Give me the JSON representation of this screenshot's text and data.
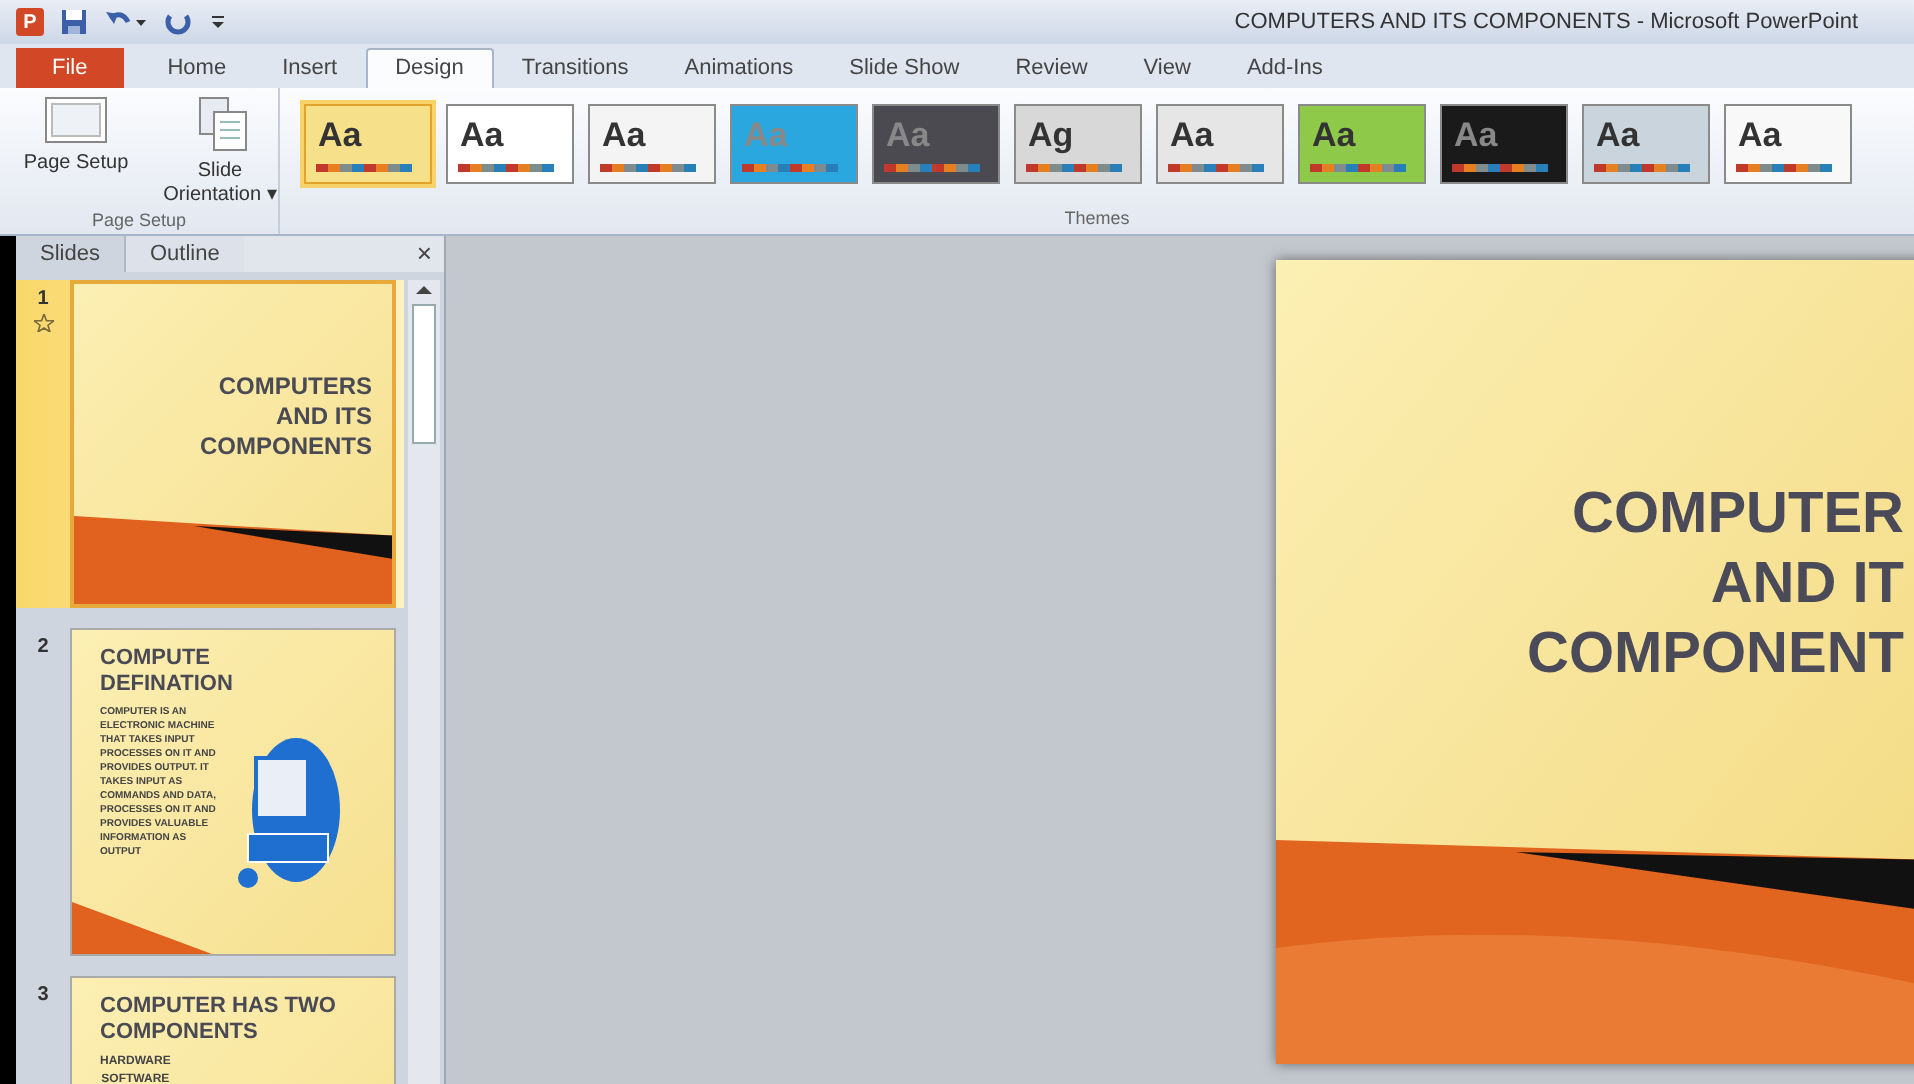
{
  "app_icon": "P",
  "window": {
    "title": "COMPUTERS AND ITS COMPONENTS  -  Microsoft PowerPoint"
  },
  "tabs": [
    {
      "label": "File",
      "kind": "file",
      "selected": false
    },
    {
      "label": "Home",
      "kind": "tab",
      "selected": false
    },
    {
      "label": "Insert",
      "kind": "tab",
      "selected": false
    },
    {
      "label": "Design",
      "kind": "tab",
      "selected": true
    },
    {
      "label": "Transitions",
      "kind": "tab",
      "selected": false
    },
    {
      "label": "Animations",
      "kind": "tab",
      "selected": false
    },
    {
      "label": "Slide Show",
      "kind": "tab",
      "selected": false
    },
    {
      "label": "Review",
      "kind": "tab",
      "selected": false
    },
    {
      "label": "View",
      "kind": "tab",
      "selected": false
    },
    {
      "label": "Add-Ins",
      "kind": "tab",
      "selected": false
    }
  ],
  "page_setup": {
    "buttons": [
      {
        "label": "Page Setup",
        "kind": "page"
      },
      {
        "label": "Slide Orientation ▾",
        "kind": "orientation"
      }
    ],
    "group_label": "Page Setup"
  },
  "themes": {
    "group_label": "Themes",
    "items": [
      {
        "label": "Aa",
        "color": "#f7e08a",
        "selected": true
      },
      {
        "label": "Aa",
        "color": "#ffffff",
        "selected": false
      },
      {
        "label": "Aa",
        "color": "#f4f4f4",
        "selected": false
      },
      {
        "label": "Aa",
        "color": "#2aa7df",
        "selected": false
      },
      {
        "label": "Aa",
        "color": "#4a4a50",
        "selected": false
      },
      {
        "label": "Ag",
        "color": "#d8d8d8",
        "selected": false
      },
      {
        "label": "Aa",
        "color": "#e6e6e6",
        "selected": false
      },
      {
        "label": "Aa",
        "color": "#8fc94a",
        "selected": false
      },
      {
        "label": "Aa",
        "color": "#1a1a1a",
        "selected": false
      },
      {
        "label": "Aa",
        "color": "#c9d4dc",
        "selected": false
      },
      {
        "label": "Aa",
        "color": "#f8f8f8",
        "selected": false
      }
    ]
  },
  "pane": {
    "tabs": [
      {
        "label": "Slides",
        "selected": true
      },
      {
        "label": "Outline",
        "selected": false
      }
    ],
    "close": "×",
    "slides": [
      {
        "number": "1",
        "selected": true,
        "kind": "title",
        "title": "COMPUTERS AND ITS COMPONENTS"
      },
      {
        "number": "2",
        "selected": false,
        "kind": "content",
        "title": "COMPUTE DEFINATION",
        "body": "COMPUTER IS AN ELECTRONIC MACHINE THAT TAKES INPUT PROCESSES ON IT AND PROVIDES OUTPUT. IT TAKES INPUT AS COMMANDS AND DATA, PROCESSES ON IT AND PROVIDES VALUABLE INFORMATION AS OUTPUT"
      },
      {
        "number": "3",
        "selected": false,
        "kind": "list",
        "title": "COMPUTER HAS TWO COMPONENTS",
        "bullets": [
          "HARDWARE",
          "SOFTWARE"
        ]
      }
    ]
  },
  "slide": {
    "title_lines": [
      "COMPUTER",
      "AND IT",
      "COMPONENT"
    ]
  }
}
